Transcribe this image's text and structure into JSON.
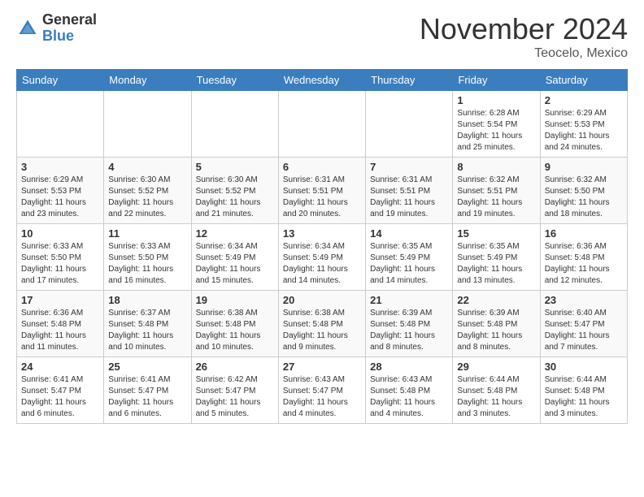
{
  "logo": {
    "general": "General",
    "blue": "Blue"
  },
  "header": {
    "month": "November 2024",
    "location": "Teocelo, Mexico"
  },
  "weekdays": [
    "Sunday",
    "Monday",
    "Tuesday",
    "Wednesday",
    "Thursday",
    "Friday",
    "Saturday"
  ],
  "rows": [
    {
      "cells": [
        {
          "day": "",
          "info": ""
        },
        {
          "day": "",
          "info": ""
        },
        {
          "day": "",
          "info": ""
        },
        {
          "day": "",
          "info": ""
        },
        {
          "day": "",
          "info": ""
        },
        {
          "day": "1",
          "info": "Sunrise: 6:28 AM\nSunset: 5:54 PM\nDaylight: 11 hours\nand 25 minutes."
        },
        {
          "day": "2",
          "info": "Sunrise: 6:29 AM\nSunset: 5:53 PM\nDaylight: 11 hours\nand 24 minutes."
        }
      ]
    },
    {
      "cells": [
        {
          "day": "3",
          "info": "Sunrise: 6:29 AM\nSunset: 5:53 PM\nDaylight: 11 hours\nand 23 minutes."
        },
        {
          "day": "4",
          "info": "Sunrise: 6:30 AM\nSunset: 5:52 PM\nDaylight: 11 hours\nand 22 minutes."
        },
        {
          "day": "5",
          "info": "Sunrise: 6:30 AM\nSunset: 5:52 PM\nDaylight: 11 hours\nand 21 minutes."
        },
        {
          "day": "6",
          "info": "Sunrise: 6:31 AM\nSunset: 5:51 PM\nDaylight: 11 hours\nand 20 minutes."
        },
        {
          "day": "7",
          "info": "Sunrise: 6:31 AM\nSunset: 5:51 PM\nDaylight: 11 hours\nand 19 minutes."
        },
        {
          "day": "8",
          "info": "Sunrise: 6:32 AM\nSunset: 5:51 PM\nDaylight: 11 hours\nand 19 minutes."
        },
        {
          "day": "9",
          "info": "Sunrise: 6:32 AM\nSunset: 5:50 PM\nDaylight: 11 hours\nand 18 minutes."
        }
      ]
    },
    {
      "cells": [
        {
          "day": "10",
          "info": "Sunrise: 6:33 AM\nSunset: 5:50 PM\nDaylight: 11 hours\nand 17 minutes."
        },
        {
          "day": "11",
          "info": "Sunrise: 6:33 AM\nSunset: 5:50 PM\nDaylight: 11 hours\nand 16 minutes."
        },
        {
          "day": "12",
          "info": "Sunrise: 6:34 AM\nSunset: 5:49 PM\nDaylight: 11 hours\nand 15 minutes."
        },
        {
          "day": "13",
          "info": "Sunrise: 6:34 AM\nSunset: 5:49 PM\nDaylight: 11 hours\nand 14 minutes."
        },
        {
          "day": "14",
          "info": "Sunrise: 6:35 AM\nSunset: 5:49 PM\nDaylight: 11 hours\nand 14 minutes."
        },
        {
          "day": "15",
          "info": "Sunrise: 6:35 AM\nSunset: 5:49 PM\nDaylight: 11 hours\nand 13 minutes."
        },
        {
          "day": "16",
          "info": "Sunrise: 6:36 AM\nSunset: 5:48 PM\nDaylight: 11 hours\nand 12 minutes."
        }
      ]
    },
    {
      "cells": [
        {
          "day": "17",
          "info": "Sunrise: 6:36 AM\nSunset: 5:48 PM\nDaylight: 11 hours\nand 11 minutes."
        },
        {
          "day": "18",
          "info": "Sunrise: 6:37 AM\nSunset: 5:48 PM\nDaylight: 11 hours\nand 10 minutes."
        },
        {
          "day": "19",
          "info": "Sunrise: 6:38 AM\nSunset: 5:48 PM\nDaylight: 11 hours\nand 10 minutes."
        },
        {
          "day": "20",
          "info": "Sunrise: 6:38 AM\nSunset: 5:48 PM\nDaylight: 11 hours\nand 9 minutes."
        },
        {
          "day": "21",
          "info": "Sunrise: 6:39 AM\nSunset: 5:48 PM\nDaylight: 11 hours\nand 8 minutes."
        },
        {
          "day": "22",
          "info": "Sunrise: 6:39 AM\nSunset: 5:48 PM\nDaylight: 11 hours\nand 8 minutes."
        },
        {
          "day": "23",
          "info": "Sunrise: 6:40 AM\nSunset: 5:47 PM\nDaylight: 11 hours\nand 7 minutes."
        }
      ]
    },
    {
      "cells": [
        {
          "day": "24",
          "info": "Sunrise: 6:41 AM\nSunset: 5:47 PM\nDaylight: 11 hours\nand 6 minutes."
        },
        {
          "day": "25",
          "info": "Sunrise: 6:41 AM\nSunset: 5:47 PM\nDaylight: 11 hours\nand 6 minutes."
        },
        {
          "day": "26",
          "info": "Sunrise: 6:42 AM\nSunset: 5:47 PM\nDaylight: 11 hours\nand 5 minutes."
        },
        {
          "day": "27",
          "info": "Sunrise: 6:43 AM\nSunset: 5:47 PM\nDaylight: 11 hours\nand 4 minutes."
        },
        {
          "day": "28",
          "info": "Sunrise: 6:43 AM\nSunset: 5:48 PM\nDaylight: 11 hours\nand 4 minutes."
        },
        {
          "day": "29",
          "info": "Sunrise: 6:44 AM\nSunset: 5:48 PM\nDaylight: 11 hours\nand 3 minutes."
        },
        {
          "day": "30",
          "info": "Sunrise: 6:44 AM\nSunset: 5:48 PM\nDaylight: 11 hours\nand 3 minutes."
        }
      ]
    }
  ]
}
